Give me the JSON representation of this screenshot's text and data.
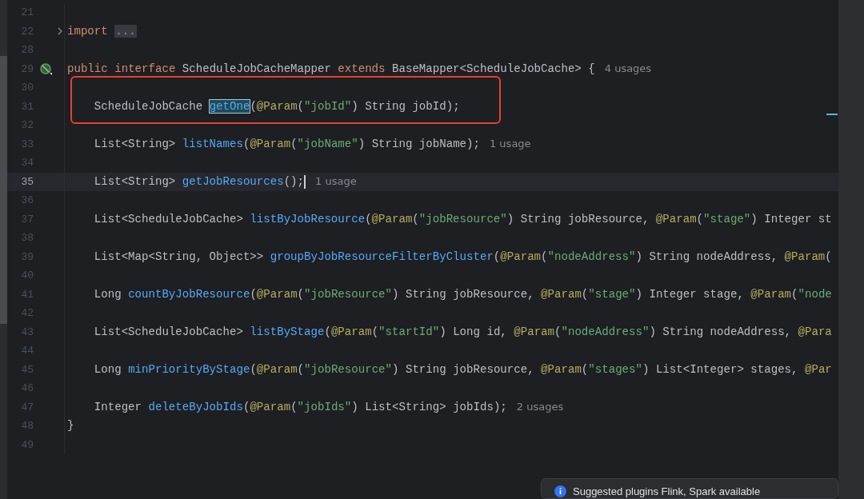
{
  "editor": {
    "lines": [
      {
        "number": "21",
        "current": false
      },
      {
        "number": "22",
        "current": false,
        "foldable": true,
        "segments": [
          {
            "kind": "keyword",
            "text": "import "
          },
          {
            "kind": "folded",
            "text": "..."
          }
        ]
      },
      {
        "number": "28",
        "current": false
      },
      {
        "number": "29",
        "current": false,
        "implemented_marker": true,
        "segments": [
          {
            "kind": "keyword",
            "text": "public "
          },
          {
            "kind": "keyword",
            "text": "interface"
          },
          {
            "kind": "plain",
            "text": " ScheduleJobCacheMapper "
          },
          {
            "kind": "keyword",
            "text": "extends"
          },
          {
            "kind": "plain",
            "text": " BaseMapper<ScheduleJobCache> {"
          }
        ],
        "hint": "4 usages"
      },
      {
        "number": "30",
        "current": false
      },
      {
        "number": "31",
        "current": false,
        "segments": [
          {
            "kind": "plain",
            "text": "    ScheduleJobCache "
          },
          {
            "kind": "match",
            "text": "getOne"
          },
          {
            "kind": "plain",
            "text": "("
          },
          {
            "kind": "annotation",
            "text": "@Param"
          },
          {
            "kind": "plain",
            "text": "("
          },
          {
            "kind": "string",
            "text": "\"jobId\""
          },
          {
            "kind": "plain",
            "text": ") String jobId);"
          }
        ]
      },
      {
        "number": "32",
        "current": false
      },
      {
        "number": "33",
        "current": false,
        "segments": [
          {
            "kind": "plain",
            "text": "    List<String> "
          },
          {
            "kind": "method",
            "text": "listNames"
          },
          {
            "kind": "plain",
            "text": "("
          },
          {
            "kind": "annotation",
            "text": "@Param"
          },
          {
            "kind": "plain",
            "text": "("
          },
          {
            "kind": "string",
            "text": "\"jobName\""
          },
          {
            "kind": "plain",
            "text": ") String jobName);"
          }
        ],
        "hint": "1 usage"
      },
      {
        "number": "34",
        "current": false
      },
      {
        "number": "35",
        "current": true,
        "segments": [
          {
            "kind": "plain",
            "text": "    List<String> "
          },
          {
            "kind": "method",
            "text": "getJobResources"
          },
          {
            "kind": "plain",
            "text": "();"
          }
        ],
        "hint": "1 usage"
      },
      {
        "number": "36",
        "current": false
      },
      {
        "number": "37",
        "current": false,
        "segments": [
          {
            "kind": "plain",
            "text": "    List<ScheduleJobCache> "
          },
          {
            "kind": "method",
            "text": "listByJobResource"
          },
          {
            "kind": "plain",
            "text": "("
          },
          {
            "kind": "annotation",
            "text": "@Param"
          },
          {
            "kind": "plain",
            "text": "("
          },
          {
            "kind": "string",
            "text": "\"jobResource\""
          },
          {
            "kind": "plain",
            "text": ") String jobResource, "
          },
          {
            "kind": "annotation",
            "text": "@Param"
          },
          {
            "kind": "plain",
            "text": "("
          },
          {
            "kind": "string",
            "text": "\"stage\""
          },
          {
            "kind": "plain",
            "text": ") Integer st"
          }
        ]
      },
      {
        "number": "38",
        "current": false
      },
      {
        "number": "39",
        "current": false,
        "segments": [
          {
            "kind": "plain",
            "text": "    List<Map<String, Object>> "
          },
          {
            "kind": "method",
            "text": "groupByJobResourceFilterByCluster"
          },
          {
            "kind": "plain",
            "text": "("
          },
          {
            "kind": "annotation",
            "text": "@Param"
          },
          {
            "kind": "plain",
            "text": "("
          },
          {
            "kind": "string",
            "text": "\"nodeAddress\""
          },
          {
            "kind": "plain",
            "text": ") String nodeAddress, "
          },
          {
            "kind": "annotation",
            "text": "@Param"
          },
          {
            "kind": "plain",
            "text": "("
          }
        ]
      },
      {
        "number": "40",
        "current": false
      },
      {
        "number": "41",
        "current": false,
        "segments": [
          {
            "kind": "plain",
            "text": "    Long "
          },
          {
            "kind": "method",
            "text": "countByJobResource"
          },
          {
            "kind": "plain",
            "text": "("
          },
          {
            "kind": "annotation",
            "text": "@Param"
          },
          {
            "kind": "plain",
            "text": "("
          },
          {
            "kind": "string",
            "text": "\"jobResource\""
          },
          {
            "kind": "plain",
            "text": ") String jobResource, "
          },
          {
            "kind": "annotation",
            "text": "@Param"
          },
          {
            "kind": "plain",
            "text": "("
          },
          {
            "kind": "string",
            "text": "\"stage\""
          },
          {
            "kind": "plain",
            "text": ") Integer stage, "
          },
          {
            "kind": "annotation",
            "text": "@Param"
          },
          {
            "kind": "plain",
            "text": "("
          },
          {
            "kind": "string",
            "text": "\"node"
          }
        ]
      },
      {
        "number": "42",
        "current": false
      },
      {
        "number": "43",
        "current": false,
        "segments": [
          {
            "kind": "plain",
            "text": "    List<ScheduleJobCache> "
          },
          {
            "kind": "method",
            "text": "listByStage"
          },
          {
            "kind": "plain",
            "text": "("
          },
          {
            "kind": "annotation",
            "text": "@Param"
          },
          {
            "kind": "plain",
            "text": "("
          },
          {
            "kind": "string",
            "text": "\"startId\""
          },
          {
            "kind": "plain",
            "text": ") Long id, "
          },
          {
            "kind": "annotation",
            "text": "@Param"
          },
          {
            "kind": "plain",
            "text": "("
          },
          {
            "kind": "string",
            "text": "\"nodeAddress\""
          },
          {
            "kind": "plain",
            "text": ") String nodeAddress, "
          },
          {
            "kind": "annotation",
            "text": "@Para"
          }
        ]
      },
      {
        "number": "44",
        "current": false
      },
      {
        "number": "45",
        "current": false,
        "segments": [
          {
            "kind": "plain",
            "text": "    Long "
          },
          {
            "kind": "method",
            "text": "minPriorityByStage"
          },
          {
            "kind": "plain",
            "text": "("
          },
          {
            "kind": "annotation",
            "text": "@Param"
          },
          {
            "kind": "plain",
            "text": "("
          },
          {
            "kind": "string",
            "text": "\"jobResource\""
          },
          {
            "kind": "plain",
            "text": ") String jobResource, "
          },
          {
            "kind": "annotation",
            "text": "@Param"
          },
          {
            "kind": "plain",
            "text": "("
          },
          {
            "kind": "string",
            "text": "\"stages\""
          },
          {
            "kind": "plain",
            "text": ") List<Integer> stages, "
          },
          {
            "kind": "annotation",
            "text": "@Par"
          }
        ]
      },
      {
        "number": "46",
        "current": false
      },
      {
        "number": "47",
        "current": false,
        "segments": [
          {
            "kind": "plain",
            "text": "    Integer "
          },
          {
            "kind": "method",
            "text": "deleteByJobIds"
          },
          {
            "kind": "plain",
            "text": "("
          },
          {
            "kind": "annotation",
            "text": "@Param"
          },
          {
            "kind": "plain",
            "text": "("
          },
          {
            "kind": "string",
            "text": "\"jobIds\""
          },
          {
            "kind": "plain",
            "text": ") List<String> jobIds);"
          }
        ],
        "hint": "2 usages"
      },
      {
        "number": "48",
        "current": false,
        "segments": [
          {
            "kind": "plain",
            "text": "}"
          }
        ]
      },
      {
        "number": "49",
        "current": false
      }
    ]
  },
  "notification": {
    "text": "Suggested plugins Flink, Spark available"
  }
}
